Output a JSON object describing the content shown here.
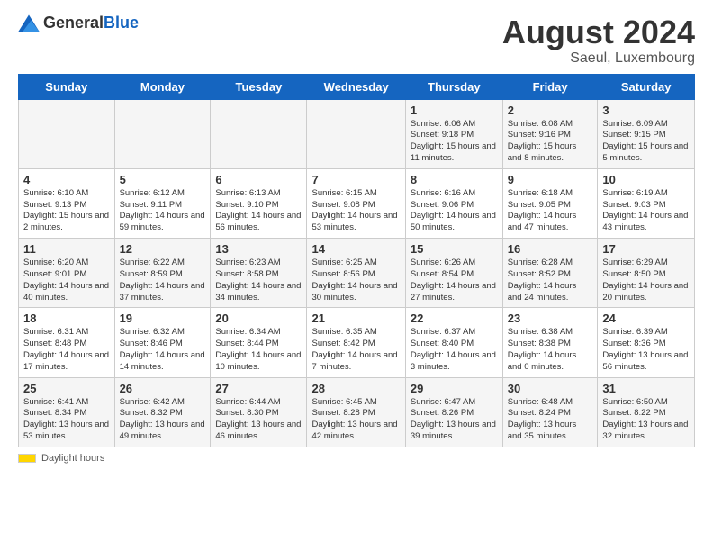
{
  "logo": {
    "text_general": "General",
    "text_blue": "Blue"
  },
  "title": "August 2024",
  "location": "Saeul, Luxembourg",
  "days_of_week": [
    "Sunday",
    "Monday",
    "Tuesday",
    "Wednesday",
    "Thursday",
    "Friday",
    "Saturday"
  ],
  "footer": {
    "daylight_label": "Daylight hours"
  },
  "weeks": [
    [
      {
        "day": "",
        "info": ""
      },
      {
        "day": "",
        "info": ""
      },
      {
        "day": "",
        "info": ""
      },
      {
        "day": "",
        "info": ""
      },
      {
        "day": "1",
        "info": "Sunrise: 6:06 AM\nSunset: 9:18 PM\nDaylight: 15 hours\nand 11 minutes."
      },
      {
        "day": "2",
        "info": "Sunrise: 6:08 AM\nSunset: 9:16 PM\nDaylight: 15 hours\nand 8 minutes."
      },
      {
        "day": "3",
        "info": "Sunrise: 6:09 AM\nSunset: 9:15 PM\nDaylight: 15 hours\nand 5 minutes."
      }
    ],
    [
      {
        "day": "4",
        "info": "Sunrise: 6:10 AM\nSunset: 9:13 PM\nDaylight: 15 hours\nand 2 minutes."
      },
      {
        "day": "5",
        "info": "Sunrise: 6:12 AM\nSunset: 9:11 PM\nDaylight: 14 hours\nand 59 minutes."
      },
      {
        "day": "6",
        "info": "Sunrise: 6:13 AM\nSunset: 9:10 PM\nDaylight: 14 hours\nand 56 minutes."
      },
      {
        "day": "7",
        "info": "Sunrise: 6:15 AM\nSunset: 9:08 PM\nDaylight: 14 hours\nand 53 minutes."
      },
      {
        "day": "8",
        "info": "Sunrise: 6:16 AM\nSunset: 9:06 PM\nDaylight: 14 hours\nand 50 minutes."
      },
      {
        "day": "9",
        "info": "Sunrise: 6:18 AM\nSunset: 9:05 PM\nDaylight: 14 hours\nand 47 minutes."
      },
      {
        "day": "10",
        "info": "Sunrise: 6:19 AM\nSunset: 9:03 PM\nDaylight: 14 hours\nand 43 minutes."
      }
    ],
    [
      {
        "day": "11",
        "info": "Sunrise: 6:20 AM\nSunset: 9:01 PM\nDaylight: 14 hours\nand 40 minutes."
      },
      {
        "day": "12",
        "info": "Sunrise: 6:22 AM\nSunset: 8:59 PM\nDaylight: 14 hours\nand 37 minutes."
      },
      {
        "day": "13",
        "info": "Sunrise: 6:23 AM\nSunset: 8:58 PM\nDaylight: 14 hours\nand 34 minutes."
      },
      {
        "day": "14",
        "info": "Sunrise: 6:25 AM\nSunset: 8:56 PM\nDaylight: 14 hours\nand 30 minutes."
      },
      {
        "day": "15",
        "info": "Sunrise: 6:26 AM\nSunset: 8:54 PM\nDaylight: 14 hours\nand 27 minutes."
      },
      {
        "day": "16",
        "info": "Sunrise: 6:28 AM\nSunset: 8:52 PM\nDaylight: 14 hours\nand 24 minutes."
      },
      {
        "day": "17",
        "info": "Sunrise: 6:29 AM\nSunset: 8:50 PM\nDaylight: 14 hours\nand 20 minutes."
      }
    ],
    [
      {
        "day": "18",
        "info": "Sunrise: 6:31 AM\nSunset: 8:48 PM\nDaylight: 14 hours\nand 17 minutes."
      },
      {
        "day": "19",
        "info": "Sunrise: 6:32 AM\nSunset: 8:46 PM\nDaylight: 14 hours\nand 14 minutes."
      },
      {
        "day": "20",
        "info": "Sunrise: 6:34 AM\nSunset: 8:44 PM\nDaylight: 14 hours\nand 10 minutes."
      },
      {
        "day": "21",
        "info": "Sunrise: 6:35 AM\nSunset: 8:42 PM\nDaylight: 14 hours\nand 7 minutes."
      },
      {
        "day": "22",
        "info": "Sunrise: 6:37 AM\nSunset: 8:40 PM\nDaylight: 14 hours\nand 3 minutes."
      },
      {
        "day": "23",
        "info": "Sunrise: 6:38 AM\nSunset: 8:38 PM\nDaylight: 14 hours\nand 0 minutes."
      },
      {
        "day": "24",
        "info": "Sunrise: 6:39 AM\nSunset: 8:36 PM\nDaylight: 13 hours\nand 56 minutes."
      }
    ],
    [
      {
        "day": "25",
        "info": "Sunrise: 6:41 AM\nSunset: 8:34 PM\nDaylight: 13 hours\nand 53 minutes."
      },
      {
        "day": "26",
        "info": "Sunrise: 6:42 AM\nSunset: 8:32 PM\nDaylight: 13 hours\nand 49 minutes."
      },
      {
        "day": "27",
        "info": "Sunrise: 6:44 AM\nSunset: 8:30 PM\nDaylight: 13 hours\nand 46 minutes."
      },
      {
        "day": "28",
        "info": "Sunrise: 6:45 AM\nSunset: 8:28 PM\nDaylight: 13 hours\nand 42 minutes."
      },
      {
        "day": "29",
        "info": "Sunrise: 6:47 AM\nSunset: 8:26 PM\nDaylight: 13 hours\nand 39 minutes."
      },
      {
        "day": "30",
        "info": "Sunrise: 6:48 AM\nSunset: 8:24 PM\nDaylight: 13 hours\nand 35 minutes."
      },
      {
        "day": "31",
        "info": "Sunrise: 6:50 AM\nSunset: 8:22 PM\nDaylight: 13 hours\nand 32 minutes."
      }
    ]
  ]
}
